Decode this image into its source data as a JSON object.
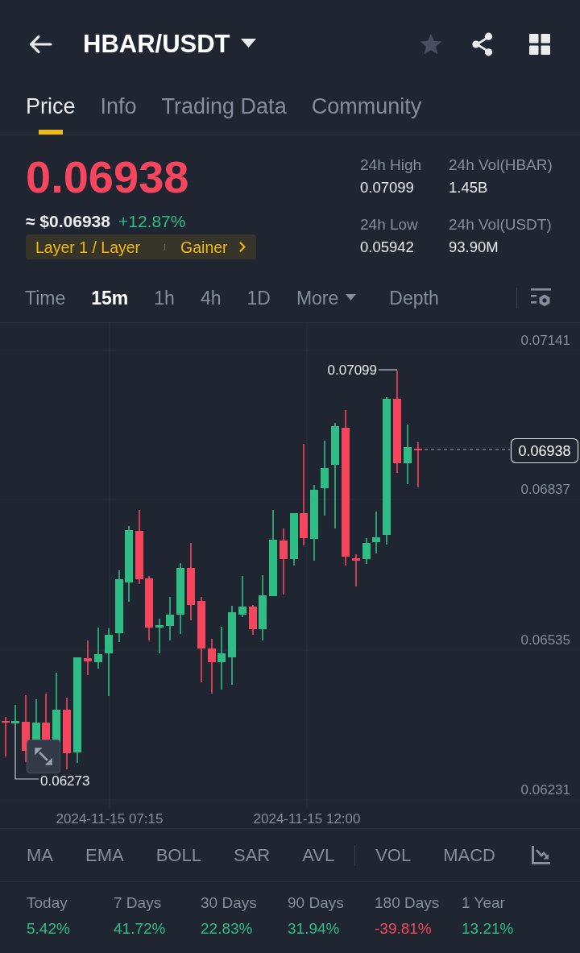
{
  "header": {
    "title": "HBAR/USDT",
    "favorited": false
  },
  "tabs": [
    {
      "label": "Price",
      "selected": true
    },
    {
      "label": "Info",
      "selected": false
    },
    {
      "label": "Trading Data",
      "selected": false
    },
    {
      "label": "Community",
      "selected": false
    }
  ],
  "ticker": {
    "price": "0.06938",
    "fiat_price": "≈ $0.06938",
    "change": "+12.87%",
    "tags": [
      "Layer 1 / Layer",
      "Gainer"
    ]
  },
  "stats": [
    {
      "label": "24h High",
      "value": "0.07099"
    },
    {
      "label": "24h Vol(HBAR)",
      "value": "1.45B"
    },
    {
      "label": "24h Low",
      "value": "0.05942"
    },
    {
      "label": "24h Vol(USDT)",
      "value": "93.90M"
    }
  ],
  "intervals": [
    {
      "label": "Time",
      "kind": "option",
      "selected": false
    },
    {
      "label": "15m",
      "kind": "option",
      "selected": true
    },
    {
      "label": "1h",
      "kind": "option",
      "selected": false
    },
    {
      "label": "4h",
      "kind": "option",
      "selected": false
    },
    {
      "label": "1D",
      "kind": "option",
      "selected": false
    },
    {
      "label": "More",
      "kind": "dropdown",
      "selected": false
    },
    {
      "label": "Depth",
      "kind": "option",
      "selected": false
    }
  ],
  "chart": {
    "price_labels": [
      "0.07141",
      "0.06837",
      "0.06535",
      "0.06231"
    ],
    "time_labels": [
      "2024-11-15 07:15",
      "2024-11-15 12:00"
    ],
    "high_label": "0.07099",
    "low_label": "0.06273",
    "last_price": "0.06938"
  },
  "main_indicators": [
    "MA",
    "EMA",
    "BOLL",
    "SAR",
    "AVL"
  ],
  "sub_indicators": [
    "VOL",
    "MACD"
  ],
  "performance": [
    {
      "period": "Today",
      "change": "5.42%",
      "color": "#2ebd85"
    },
    {
      "period": "7 Days",
      "change": "41.72%",
      "color": "#2ebd85"
    },
    {
      "period": "30 Days",
      "change": "22.83%",
      "color": "#2ebd85"
    },
    {
      "period": "90 Days",
      "change": "31.94%",
      "color": "#2ebd85"
    },
    {
      "period": "180 Days",
      "change": "-39.81%",
      "color": "#f6465d"
    },
    {
      "period": "1 Year",
      "change": "13.21%",
      "color": "#2ebd85"
    }
  ]
}
